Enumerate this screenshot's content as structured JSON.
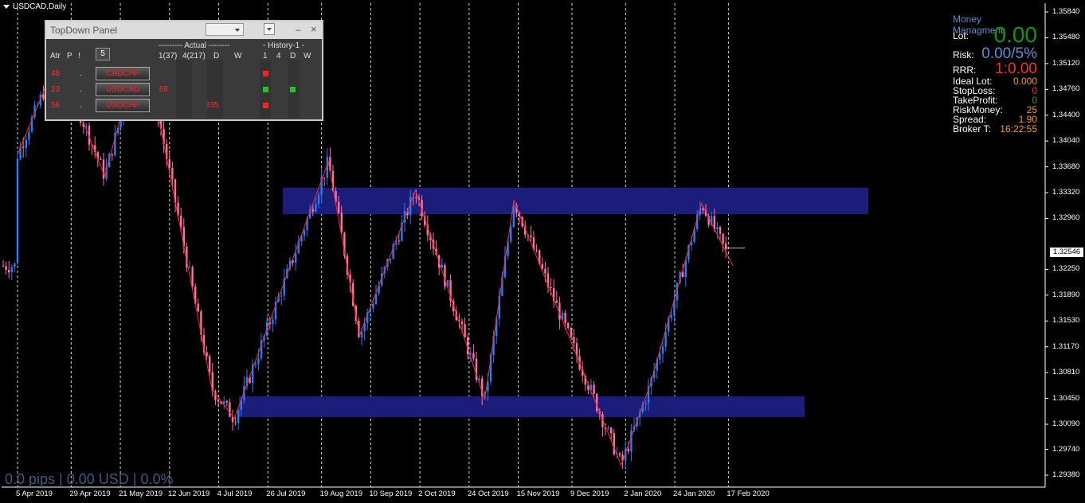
{
  "window": {
    "title": "USDCAD,Daily"
  },
  "status": {
    "pips_text": "0.0 pips | 0.00 USD | 0.0%"
  },
  "price_axis": {
    "labels": [
      "1.35840",
      "1.35480",
      "1.35120",
      "1.34760",
      "1.34400",
      "1.34040",
      "1.33680",
      "1.33320",
      "1.32960",
      "1.32250",
      "1.31890",
      "1.31530",
      "1.31170",
      "1.30810",
      "1.30450",
      "1.30090",
      "1.29740",
      "1.29380"
    ],
    "current_price": "1.32546"
  },
  "time_axis": {
    "labels": [
      "5 Apr 2019",
      "29 Apr 2019",
      "21 May 2019",
      "12 Jun 2019",
      "4 Jul 2019",
      "26 Jul 2019",
      "19 Aug 2019",
      "10 Sep 2019",
      "2 Oct 2019",
      "24 Oct 2019",
      "15 Nov 2019",
      "9 Dec 2019",
      "2 Jan 2020",
      "24 Jan 2020",
      "17 Feb 2020"
    ]
  },
  "topdown_panel": {
    "title": "TopDown Panel",
    "dropdown_value": "",
    "minimize_label": "–",
    "close_label": "×",
    "col_atr": "Atr",
    "col_p": "P",
    "col_excl": "!",
    "period_button": "5",
    "actual_header": "--------- Actual --------",
    "history_header": "- History-1 -",
    "actual_cols": [
      "1(37)",
      "4(217)",
      "D",
      "W"
    ],
    "history_cols": [
      "1",
      "4",
      "D",
      "W"
    ],
    "rows": [
      {
        "atr": "48",
        "p": ".",
        "pair": "CADCHF",
        "a1": "",
        "a4": "",
        "hist": [
          true,
          false,
          false,
          false
        ],
        "colors": [
          "#ff2020",
          "",
          "",
          ""
        ]
      },
      {
        "atr": "23",
        "p": ".",
        "pair": "USDCAD",
        "a1": "68",
        "a4": "",
        "hist": [
          true,
          false,
          true,
          false
        ],
        "colors": [
          "#22c422",
          "",
          "#22c422",
          ""
        ]
      },
      {
        "atr": "56",
        "p": ".",
        "pair": "USDCHF",
        "a1": "",
        "a4": "335",
        "hist": [
          true,
          false,
          false,
          false
        ],
        "colors": [
          "#ff2020",
          "",
          "",
          ""
        ]
      }
    ]
  },
  "money_management": {
    "title": "Money Managment:",
    "lot_label": "Lot:",
    "lot_value": "0.00",
    "risk_label": "Risk:",
    "risk_value": "0.00/5%",
    "rrr_label": "RRR:",
    "rrr_value": "1:0.00",
    "ideal_lot_label": "Ideal Lot:",
    "ideal_lot_value": "0.000",
    "stoploss_label": "StopLoss:",
    "stoploss_value": "0",
    "takeprofit_label": "TakeProfit:",
    "takeprofit_value": "0",
    "riskmoney_label": "RiskMoney:",
    "riskmoney_value": "25",
    "spread_label": "Spread:",
    "spread_value": "1.90",
    "broker_label": "Broker T:",
    "broker_value": "16:22:55",
    "colors": {
      "title": "#5f8fcf",
      "lot": "#0a9a0a",
      "risk": "#5f8fcf",
      "rrr": "#ff2a2a",
      "orange": "#ff9a1a",
      "green": "#1aa51a"
    }
  },
  "chart_data": {
    "type": "candlestick",
    "symbol": "USDCAD",
    "timeframe": "Daily",
    "ylim": [
      1.2938,
      1.3584
    ],
    "zones": [
      {
        "from": 1.3302,
        "to": 1.3339
      },
      {
        "from": 1.3019,
        "to": 1.3048
      }
    ],
    "zigzag": [
      [
        "2019-04-05",
        1.3385
      ],
      [
        "2019-04-23",
        1.3521
      ],
      [
        "2019-05-14",
        1.3355
      ],
      [
        "2019-05-31",
        1.355
      ],
      [
        "2019-06-12",
        1.336
      ],
      [
        "2019-07-01",
        1.3058
      ],
      [
        "2019-07-11",
        1.3017
      ],
      [
        "2019-08-22",
        1.3375
      ],
      [
        "2019-09-05",
        1.3133
      ],
      [
        "2019-09-30",
        1.3335
      ],
      [
        "2019-10-31",
        1.3043
      ],
      [
        "2019-11-13",
        1.3321
      ],
      [
        "2019-12-31",
        1.2952
      ],
      [
        "2020-01-13",
        1.3064
      ],
      [
        "2020-02-05",
        1.3317
      ],
      [
        "2020-02-19",
        1.323
      ]
    ],
    "colors": {
      "bull": "#1e7fff",
      "bear": "#ff6ea8",
      "zone": "#1c1d7a",
      "zigzag": "#ff2a2a",
      "grid": "#ffffff"
    }
  }
}
